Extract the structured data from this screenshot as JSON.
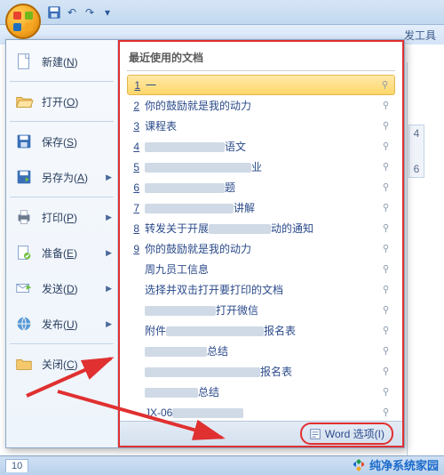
{
  "qat": {
    "save": "💾",
    "undo": "↶",
    "redo": "↷"
  },
  "tabs": {
    "devtools": "发工具"
  },
  "menu": {
    "new": "新建(<u>N</u>)",
    "open": "打开(<u>O</u>)",
    "save": "保存(<u>S</u>)",
    "saveas": "另存为(<u>A</u>)",
    "print": "打印(<u>P</u>)",
    "prepare": "准备(<u>E</u>)",
    "send": "发送(<u>D</u>)",
    "publish": "发布(<u>U</u>)",
    "close": "关闭(<u>C</u>)"
  },
  "recent": {
    "header": "最近使用的文档",
    "items": [
      {
        "n": "1",
        "t": "一",
        "sel": true
      },
      {
        "n": "2",
        "t": "你的鼓励就是我的动力"
      },
      {
        "n": "3",
        "t": "课程表"
      },
      {
        "n": "4",
        "t": "",
        "b": 90,
        "suffix": "语文"
      },
      {
        "n": "5",
        "t": "",
        "b": 120,
        "suffix": "业"
      },
      {
        "n": "6",
        "t": "",
        "b": 90,
        "suffix": "题"
      },
      {
        "n": "7",
        "t": "",
        "b": 100,
        "suffix": "讲解"
      },
      {
        "n": "8",
        "t": "转发关于开展",
        "b": 70,
        "suffix": "动的通知"
      },
      {
        "n": "9",
        "t": "你的鼓励就是我的动力"
      },
      {
        "n": "",
        "t": "周九员工信息"
      },
      {
        "n": "",
        "t": "选择并双击打开要打印的文档"
      },
      {
        "n": "",
        "t": "",
        "b": 80,
        "suffix": "打开微信"
      },
      {
        "n": "",
        "t": "附件",
        "b": 110,
        "suffix": "报名表"
      },
      {
        "n": "",
        "t": "",
        "b": 70,
        "suffix": "总结"
      },
      {
        "n": "",
        "t": "",
        "b": 130,
        "suffix": "报名表"
      },
      {
        "n": "",
        "t": "",
        "b": 60,
        "suffix": "总结"
      },
      {
        "n": "",
        "t": "JX-06",
        "b": 80
      }
    ]
  },
  "footer": {
    "options": "Word 选项(I)"
  },
  "ruler": {
    "a": "4",
    "b": "6"
  },
  "status": {
    "page": "10"
  },
  "watermark": "纯净系统家园"
}
